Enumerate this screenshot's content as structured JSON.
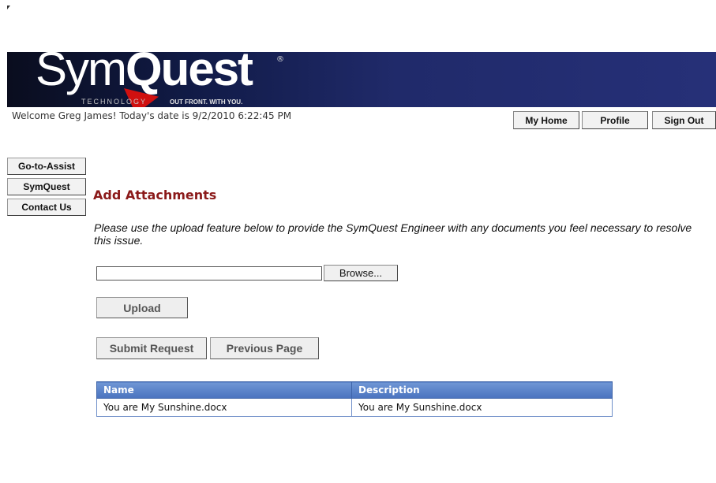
{
  "header": {
    "logo_text": "SymQuest",
    "logo_registered": "®",
    "logo_tagline_left": "TECHNOLOGY",
    "logo_tagline_right": "OUT FRONT. WITH YOU."
  },
  "welcome_text": "Welcome Greg James! Today's date is 9/2/2010 6:22:45 PM",
  "top_nav": {
    "my_home": "My Home",
    "profile": "Profile",
    "sign_out": "Sign Out"
  },
  "side_nav": {
    "go_to_assist": "Go-to-Assist",
    "symquest": "SymQuest",
    "contact_us": "Contact Us"
  },
  "main": {
    "title": "Add Attachments",
    "instructions": "Please use the upload feature below to provide the SymQuest Engineer with any documents you feel necessary to resolve this issue.",
    "file_input_value": "",
    "browse_label": "Browse...",
    "upload_label": "Upload",
    "submit_label": "Submit Request",
    "previous_label": "Previous Page"
  },
  "attachments": {
    "headers": [
      "Name",
      "Description"
    ],
    "rows": [
      [
        "You are My Sunshine.docx",
        "You are My Sunshine.docx"
      ]
    ]
  },
  "colors": {
    "title": "#8b1a1a",
    "table_header": "#5a82c8",
    "banner": "#1a2360"
  }
}
